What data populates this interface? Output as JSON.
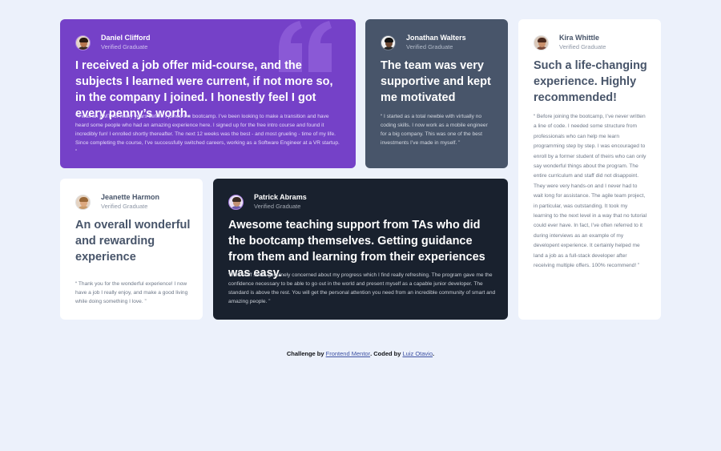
{
  "colors": {
    "page_bg": "#ECF1FB",
    "purple": "#7541C8",
    "slate": "#48556A",
    "dark": "#19212E",
    "white": "#FFFFFF",
    "link": "#3E52A3"
  },
  "testimonials": [
    {
      "name": "Daniel Clifford",
      "role": "Verified Graduate",
      "title": "I received a job offer mid-course, and the subjects I learned were current, if not more so, in the company I joined. I honestly feel I got every penny’s worth.",
      "quote": "“ I was an EMT for many years before I joined the bootcamp. I’ve been looking to make a transition and have heard some people who had an amazing experience here. I signed up for the free intro course and found it incredibly fun! I enrolled shortly thereafter. The next 12 weeks was the best - and most grueling - time of my life. Since completing the course, I’ve successfully switched careers, working as a Software Engineer at a VR startup. ”",
      "avatar_icon": "avatar-icon"
    },
    {
      "name": "Jonathan Walters",
      "role": "Verified Graduate",
      "title": "The team was very supportive and kept me motivated",
      "quote": "“ I started as a total newbie with virtually no coding skills. I now work as a mobile engineer for a big company. This was one of the best investments I’ve made in myself. ”",
      "avatar_icon": "avatar-icon"
    },
    {
      "name": "Kira Whittle",
      "role": "Verified Graduate",
      "title": "Such a life-changing experience. Highly recommended!",
      "quote": "“ Before joining the bootcamp, I’ve never written a line of code. I needed some structure from professionals who can help me learn programming step by step. I was encouraged to enroll by a former student of theirs who can only say wonderful things about the program. The entire curriculum and staff did not disappoint. They were very hands-on and I never had to wait long for assistance. The agile team project, in particular, was outstanding. It took my learning to the next level in a way that no tutorial could ever have. In fact, I’ve often referred to it during interviews as an example of my developent experience. It certainly helped me land a job as a full-stack developer after receiving multiple offers. 100% recommend! ”",
      "avatar_icon": "avatar-icon"
    },
    {
      "name": "Jeanette Harmon",
      "role": "Verified Graduate",
      "title": "An overall wonderful and rewarding experience",
      "quote": "“ Thank you for the wonderful experience! I now have a job I really enjoy, and make a good living while doing something I love. ”",
      "avatar_icon": "avatar-icon"
    },
    {
      "name": "Patrick Abrams",
      "role": "Verified Graduate",
      "title": "Awesome teaching support from TAs who did the bootcamp themselves. Getting guidance from them and learning from their experiences was easy.",
      "quote": "“ The staff seem genuinely concerned about my progress which I find really refreshing. The program gave me the confidence necessary to be able to go out in the world and present myself as a capable junior developer. The standard is above the rest. You will get the personal attention you need from an incredible community of smart and amazing people. ”",
      "avatar_icon": "avatar-icon"
    }
  ],
  "footer": {
    "prefix": "Challenge by ",
    "link1": "Frontend Mentor",
    "middle": ". Coded by ",
    "link2": "Luiz Otavio",
    "suffix": "."
  },
  "decor": {
    "quote_icon": "quotation-mark-icon"
  }
}
